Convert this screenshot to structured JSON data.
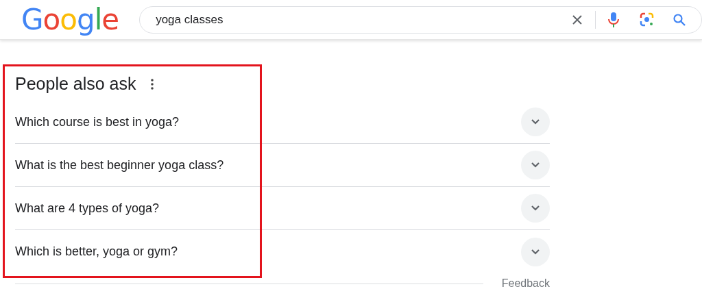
{
  "logo": "Google",
  "search": {
    "value": "yoga classes"
  },
  "people_also_ask": {
    "title": "People also ask",
    "questions": [
      {
        "text": "Which course is best in yoga?",
        "expanded": false
      },
      {
        "text": "What is the best beginner yoga class?",
        "expanded": false
      },
      {
        "text": "What are 4 types of yoga?",
        "expanded": false
      },
      {
        "text": "Which is better, yoga or gym?",
        "expanded": false
      }
    ],
    "feedback": "Feedback"
  }
}
